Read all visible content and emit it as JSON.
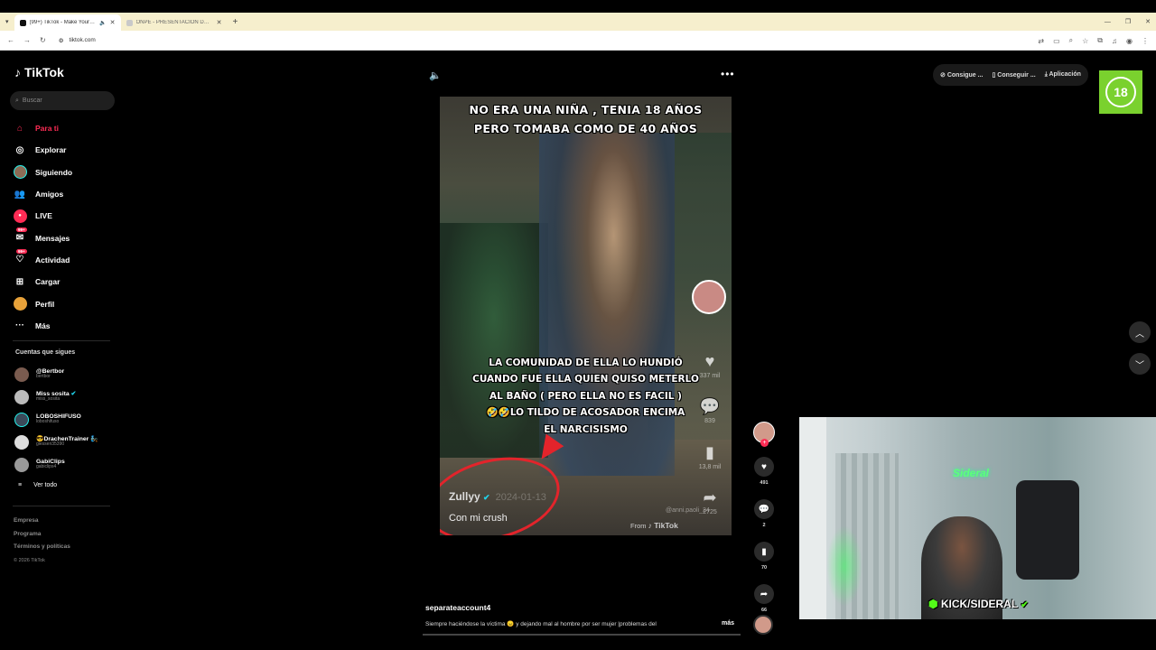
{
  "browser": {
    "tabs": [
      {
        "title": "(99+) TikTok - Make Your Day",
        "active": true
      },
      {
        "title": "ONPE - PRESENTACIÓN DE RES",
        "active": false
      }
    ],
    "url": "tiktok.com"
  },
  "sidebar": {
    "logo": "TikTok",
    "search_placeholder": "Buscar",
    "nav": [
      {
        "label": "Para ti",
        "icon": "home-icon"
      },
      {
        "label": "Explorar",
        "icon": "compass-icon"
      },
      {
        "label": "Siguiendo",
        "icon": "avatar-icon"
      },
      {
        "label": "Amigos",
        "icon": "friends-icon"
      },
      {
        "label": "LIVE",
        "icon": "live-icon"
      },
      {
        "label": "Mensajes",
        "icon": "message-icon",
        "badge": "99+"
      },
      {
        "label": "Actividad",
        "icon": "activity-icon",
        "badge": "99+"
      },
      {
        "label": "Cargar",
        "icon": "upload-icon"
      },
      {
        "label": "Perfil",
        "icon": "profile-icon"
      },
      {
        "label": "Más",
        "icon": "more-icon"
      }
    ],
    "following_title": "Cuentas que sigues",
    "following": [
      {
        "name": "@Bertbor",
        "handle": "bertbor"
      },
      {
        "name": "Miss sosita",
        "handle": "miss_sosita",
        "verified": true
      },
      {
        "name": "LOBOSHIFUSO",
        "handle": "loboshifuso"
      },
      {
        "name": "😎DrachenTrainer 🧞",
        "handle": "giessen35390"
      },
      {
        "name": "GabiClips",
        "handle": "gabiclips4"
      }
    ],
    "see_all": "Ver todo",
    "footer": [
      "Empresa",
      "Programa",
      "Términos y políticas"
    ],
    "copyright": "© 2026 TikTok"
  },
  "topbar": {
    "buttons": [
      "Consigue ...",
      "Conseguir ...",
      "Aplicación"
    ],
    "age_badge": "18"
  },
  "video": {
    "top_text": [
      "NO ERA UNA NIÑA , TENIA 18 AÑOS",
      "PERO TOMABA COMO DE 40 AÑOS"
    ],
    "mid_text": [
      "LA COMUNIDAD DE ELLA LO HUNDIÓ",
      "CUANDO FUE ELLA QUIEN QUISO METERLO",
      "AL BAÑO ( PERO ELLA NO ES FACIL )",
      "🤣🤣LO TILDO DE ACOSADOR  ENCIMA",
      "EL NARCISISMO"
    ],
    "inner_counts": [
      "337 mil",
      "839",
      "13,8 mil",
      "2725"
    ],
    "inner_user": "Zullyy",
    "inner_date": "2024-01-13",
    "inner_caption": "Con mi crush",
    "inner_credit": "@anni.paoli_24",
    "from_label": "From",
    "from_brand": "TikTok"
  },
  "actions": {
    "likes": "491",
    "comments": "2",
    "saves": "70",
    "shares": "66"
  },
  "post": {
    "author": "separateaccount4",
    "description": "Siempre haciéndose la víctima 😠 y dejando mal al hombre por ser mujer |problemas del",
    "more": "más",
    "progress": 0.0
  },
  "stream": {
    "overlay": "KICK/SIDERAL",
    "sign": "Sideral"
  }
}
